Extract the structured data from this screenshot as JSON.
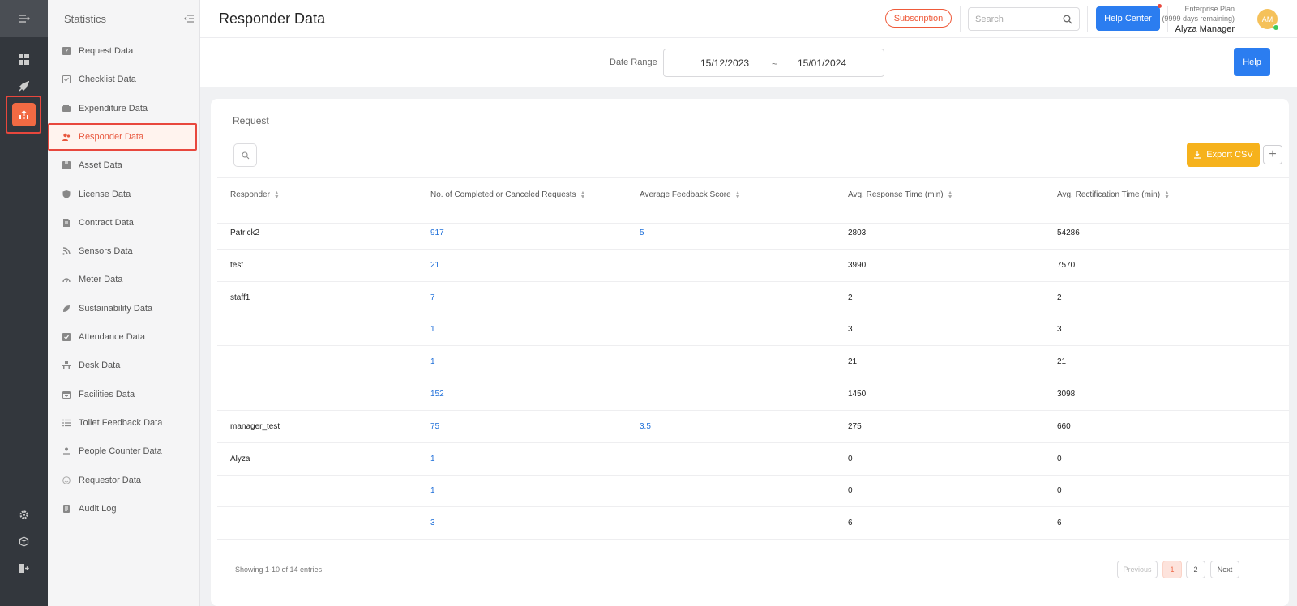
{
  "sidebar": {
    "title": "Statistics",
    "items": [
      {
        "label": "Request Data",
        "icon": "question-icon"
      },
      {
        "label": "Checklist Data",
        "icon": "checklist-icon"
      },
      {
        "label": "Expenditure Data",
        "icon": "wallet-icon"
      },
      {
        "label": "Responder Data",
        "icon": "users-icon",
        "active": true
      },
      {
        "label": "Asset Data",
        "icon": "box-icon"
      },
      {
        "label": "License Data",
        "icon": "shield-icon"
      },
      {
        "label": "Contract Data",
        "icon": "contract-icon"
      },
      {
        "label": "Sensors Data",
        "icon": "wifi-icon"
      },
      {
        "label": "Meter Data",
        "icon": "gauge-icon"
      },
      {
        "label": "Sustainability Data",
        "icon": "leaf-icon"
      },
      {
        "label": "Attendance Data",
        "icon": "check-square-icon"
      },
      {
        "label": "Desk Data",
        "icon": "desk-icon"
      },
      {
        "label": "Facilities Data",
        "icon": "calendar-icon"
      },
      {
        "label": "Toilet Feedback Data",
        "icon": "list-icon"
      },
      {
        "label": "People Counter Data",
        "icon": "people-icon"
      },
      {
        "label": "Requestor Data",
        "icon": "smile-icon"
      },
      {
        "label": "Audit Log",
        "icon": "document-icon"
      }
    ]
  },
  "header": {
    "title": "Responder Data",
    "subscription_label": "Subscription",
    "search_placeholder": "Search",
    "help_center_label": "Help Center",
    "plan_name": "Enterprise Plan",
    "plan_days": "(9999 days remaining)",
    "user_name": "Alyza Manager",
    "avatar_initials": "AM"
  },
  "date_range": {
    "label": "Date Range",
    "start": "15/12/2023",
    "separator": "~",
    "end": "15/01/2024",
    "help_label": "Help"
  },
  "card": {
    "title": "Request",
    "export_label": "Export CSV",
    "plus_label": "+"
  },
  "table": {
    "columns": [
      "Responder",
      "No. of Completed or Canceled Requests",
      "Average Feedback Score",
      "Avg. Response Time (min)",
      "Avg. Rectification Time (min)"
    ],
    "rows": [
      [
        "Patrick2",
        "917",
        "5",
        "2803",
        "54286"
      ],
      [
        "test",
        "21",
        "",
        "3990",
        "7570"
      ],
      [
        "staff1",
        "7",
        "",
        "2",
        "2"
      ],
      [
        "",
        "1",
        "",
        "3",
        "3"
      ],
      [
        "",
        "1",
        "",
        "21",
        "21"
      ],
      [
        "",
        "152",
        "",
        "1450",
        "3098"
      ],
      [
        "manager_test",
        "75",
        "3.5",
        "275",
        "660"
      ],
      [
        "Alyza",
        "1",
        "",
        "0",
        "0"
      ],
      [
        "",
        "1",
        "",
        "0",
        "0"
      ],
      [
        "",
        "3",
        "",
        "6",
        "6"
      ]
    ]
  },
  "pagination": {
    "entries_text": "Showing 1-10 of 14 entries",
    "previous_label": "Previous",
    "pages": [
      "1",
      "2"
    ],
    "next_label": "Next"
  },
  "colors": {
    "accent": "#f26a43",
    "primary_blue": "#2b7df0",
    "export": "#f6b21c",
    "link": "#1e6fd9"
  }
}
